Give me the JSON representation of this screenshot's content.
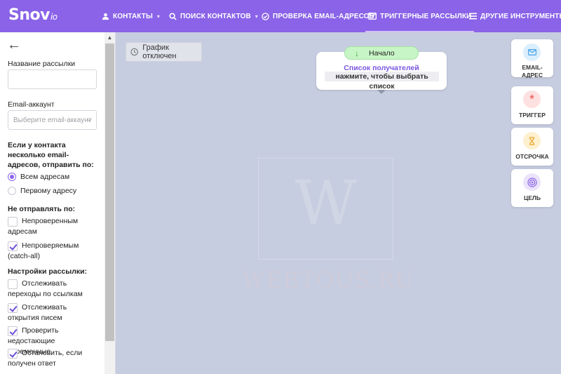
{
  "nav": {
    "logo": "Snov",
    "logo_suffix": "io",
    "items": [
      {
        "label": "Контакты",
        "icon": "person-icon"
      },
      {
        "label": "Поиск контактов",
        "icon": "search-icon"
      },
      {
        "label": "Проверка email-адресов",
        "icon": "check-circle-icon"
      },
      {
        "label": "Триггерные рассылки",
        "icon": "mail-icon"
      },
      {
        "label": "Другие инструменты",
        "icon": "menu-icon"
      }
    ],
    "active_index": 3
  },
  "sidebar": {
    "back": "←",
    "campaign_name_label": "Название рассылки",
    "campaign_name_value": "",
    "email_account_label": "Email-аккаунт",
    "email_account_placeholder": "Выберите email-аккаунт",
    "multi_address_label": "Если у контакта несколько email-адресов, отправить по:",
    "multi_address_options": [
      "Всем адресам",
      "Первому адресу"
    ],
    "multi_address_selected": 0,
    "dont_send_label": "Не отправлять по:",
    "dont_send_options": [
      {
        "label": "Непроверенным адресам",
        "checked": false
      },
      {
        "label": "Непроверяемым (catch-all)",
        "checked": true
      }
    ],
    "settings_label": "Настройки рассылки:",
    "settings_options": [
      {
        "label": "Отслеживать переходы по ссылкам",
        "checked": false
      },
      {
        "label": "Отслеживать открытия писем",
        "checked": true
      },
      {
        "label": "Проверить недостающие переменные",
        "checked": true
      },
      {
        "label": "Остановить, если получен ответ",
        "checked": true
      }
    ]
  },
  "canvas": {
    "schedule_label": "График отключен",
    "start_label": "Начало",
    "node_title": "Список получателей",
    "node_subtitle": "нажмите, чтобы выбрать список",
    "watermark_letter": "W",
    "watermark_text": "WEBTOUS.RU"
  },
  "tools": [
    {
      "label": "EMAIL-АДРЕС",
      "icon": "envelope-icon",
      "color": "#4aa3e8",
      "bg": "#dbeefc"
    },
    {
      "label": "ТРИГГЕР",
      "icon": "asterisk-icon",
      "color": "#f06a6a",
      "bg": "#fde0e0"
    },
    {
      "label": "ОТСРОЧКА",
      "icon": "hourglass-icon",
      "color": "#e8a42a",
      "bg": "#fdf0cf"
    },
    {
      "label": "ЦЕЛЬ",
      "icon": "target-icon",
      "color": "#8a63e8",
      "bg": "#ebe3fb"
    }
  ],
  "colors": {
    "brand": "#8a63e8",
    "canvas": "#c7cde0"
  }
}
